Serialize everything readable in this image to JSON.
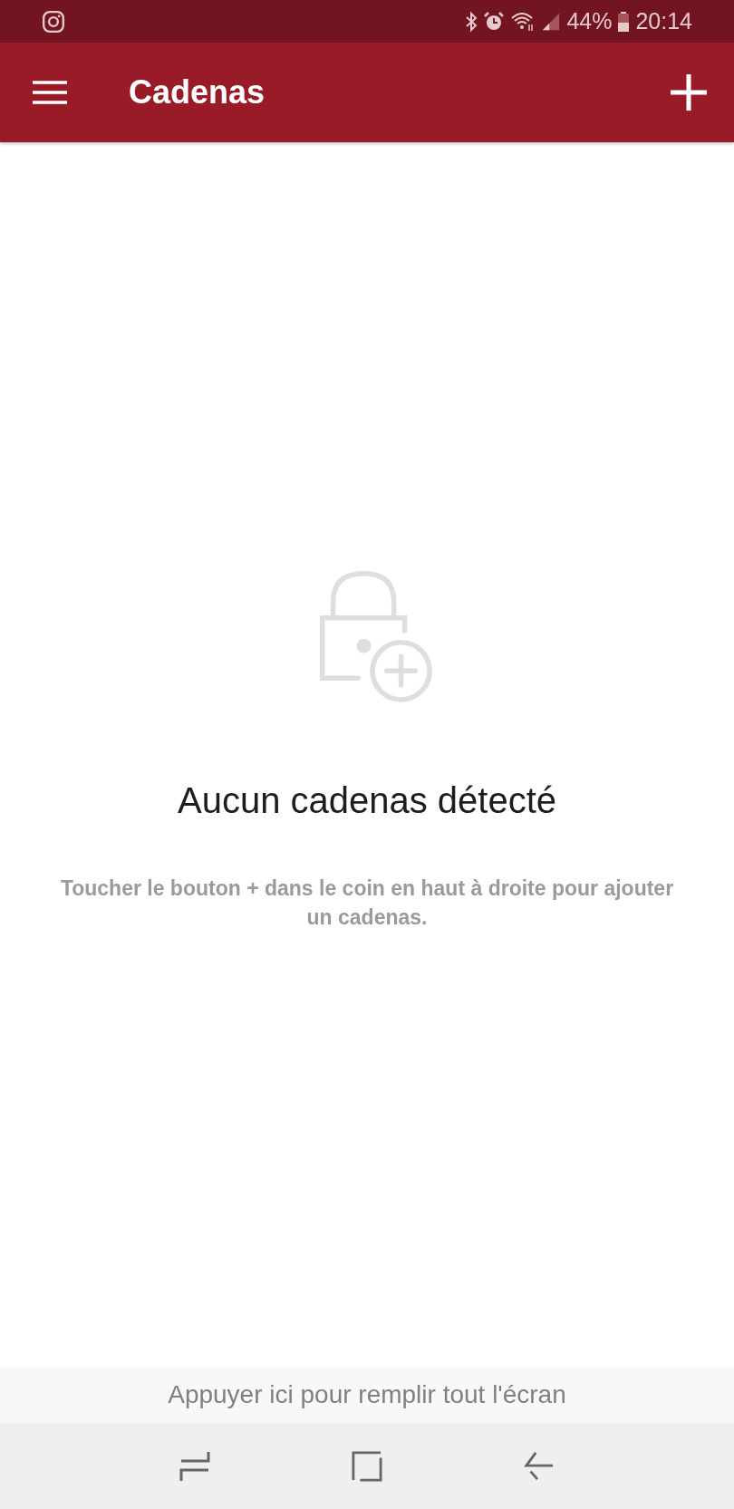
{
  "status_bar": {
    "battery_percent": "44%",
    "time": "20:14"
  },
  "app_bar": {
    "title": "Cadenas"
  },
  "empty_state": {
    "title": "Aucun cadenas détecté",
    "message": "Toucher le bouton + dans le coin en haut à droite pour ajouter un cadenas."
  },
  "fullscreen_banner": {
    "text": "Appuyer ici pour remplir tout l'écran"
  }
}
